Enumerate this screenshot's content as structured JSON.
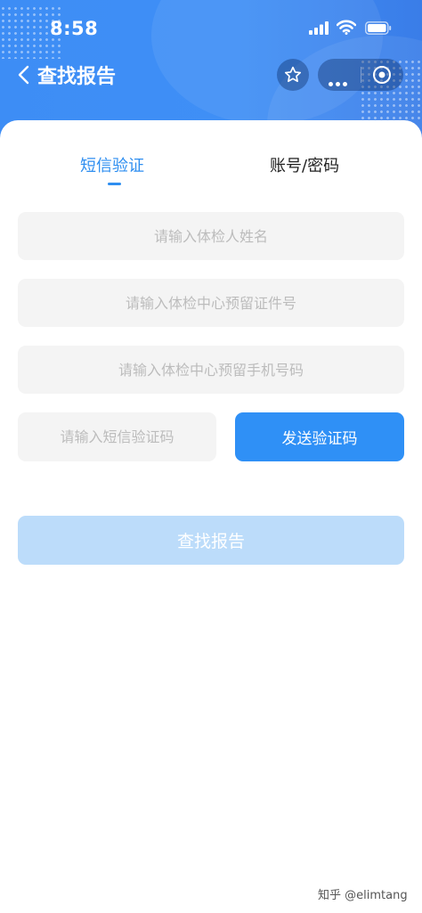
{
  "status_bar": {
    "time": "8:58"
  },
  "nav": {
    "title": "查找报告"
  },
  "tabs": [
    {
      "label": "短信验证",
      "active": true
    },
    {
      "label": "账号/密码",
      "active": false
    }
  ],
  "form": {
    "name_placeholder": "请输入体检人姓名",
    "id_placeholder": "请输入体检中心预留证件号",
    "phone_placeholder": "请输入体检中心预留手机号码",
    "code_placeholder": "请输入短信验证码",
    "send_code_label": "发送验证码",
    "submit_label": "查找报告"
  },
  "watermark": "知乎 @elimtang",
  "colors": {
    "header": "#3d8df5",
    "accent": "#2e8ef0",
    "field_bg": "#f4f4f4",
    "button_disabled": "#bcdcfa"
  },
  "icons": [
    "back-arrow-icon",
    "star-icon",
    "more-dots-icon",
    "target-icon",
    "signal-icon",
    "wifi-icon",
    "battery-icon"
  ]
}
